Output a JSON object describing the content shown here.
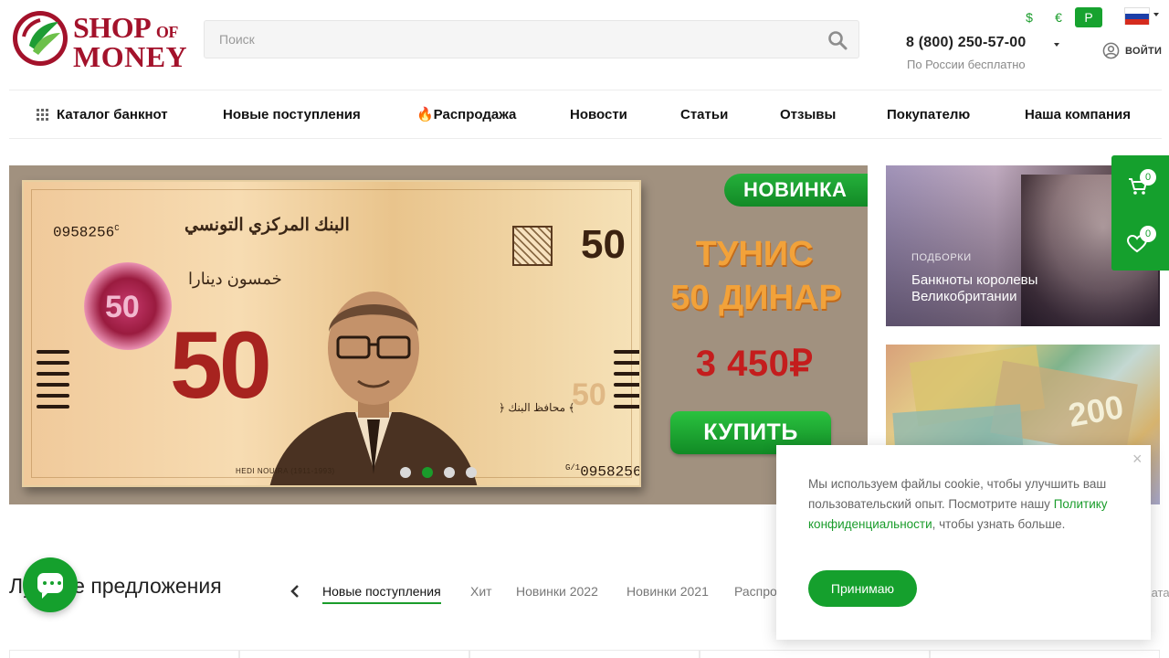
{
  "logo": {
    "line1": "SHOP",
    "of": "OF",
    "line2": "MONEY"
  },
  "search": {
    "placeholder": "Поиск"
  },
  "currency": {
    "usd": "$",
    "eur": "€",
    "rub": "Р",
    "active": "rub"
  },
  "contacts": {
    "phone": "8 (800) 250-57-00",
    "note": "По России бесплатно"
  },
  "login": {
    "label": "ВОЙТИ"
  },
  "nav": [
    {
      "label": "Каталог банкнот"
    },
    {
      "label": "Новые поступления"
    },
    {
      "label": "🔥Распродажа"
    },
    {
      "label": "Новости"
    },
    {
      "label": "Статьи"
    },
    {
      "label": "Отзывы"
    },
    {
      "label": "Покупателю"
    },
    {
      "label": "Наша компания"
    }
  ],
  "banner": {
    "badge": "НОВИНКА",
    "country": "ТУНИС",
    "denomination": "50 ДИНАР",
    "price": "3 450₽",
    "button": "КУПИТЬ",
    "slides_total": 4,
    "active_slide": 2,
    "note": {
      "serial": "0958256",
      "serial_prefix_top": "C",
      "serial_prefix_bottom": "G/1",
      "value": "50",
      "arabic_title": "البنك المركزي التونسي",
      "arabic_value": "خمسون دينارا",
      "caption": "HEDI NOUIRA (1911-1993)"
    }
  },
  "side_cards": [
    {
      "tag": "ПОДБОРКИ",
      "title": "Банкноты королевы Великобритании"
    },
    {
      "tag": "",
      "title": ""
    }
  ],
  "sticky": {
    "cart_count": "0",
    "favorites_count": "0"
  },
  "offers": {
    "title": "Лучшие предложения",
    "tabs": [
      {
        "label": "Новые поступления",
        "active": true
      },
      {
        "label": "Хит",
        "active": false
      },
      {
        "label": "Новинки 2022",
        "active": false
      },
      {
        "label": "Новинки 2021",
        "active": false
      },
      {
        "label": "Распродажа",
        "active": false
      }
    ],
    "more": "Каталог"
  },
  "cookie": {
    "text_before": "Мы используем файлы cookie, чтобы улучшить ваш пользовательский опыт. Посмотрите нашу ",
    "link": "Политику конфиденциальности",
    "text_after": ", чтобы узнать больше.",
    "button": "Принимаю",
    "close": "×"
  },
  "colors": {
    "brand_green": "#15a02d",
    "logo_red": "#a3122b",
    "price_red": "#c41d1d",
    "promo_orange": "#f2a23a"
  }
}
